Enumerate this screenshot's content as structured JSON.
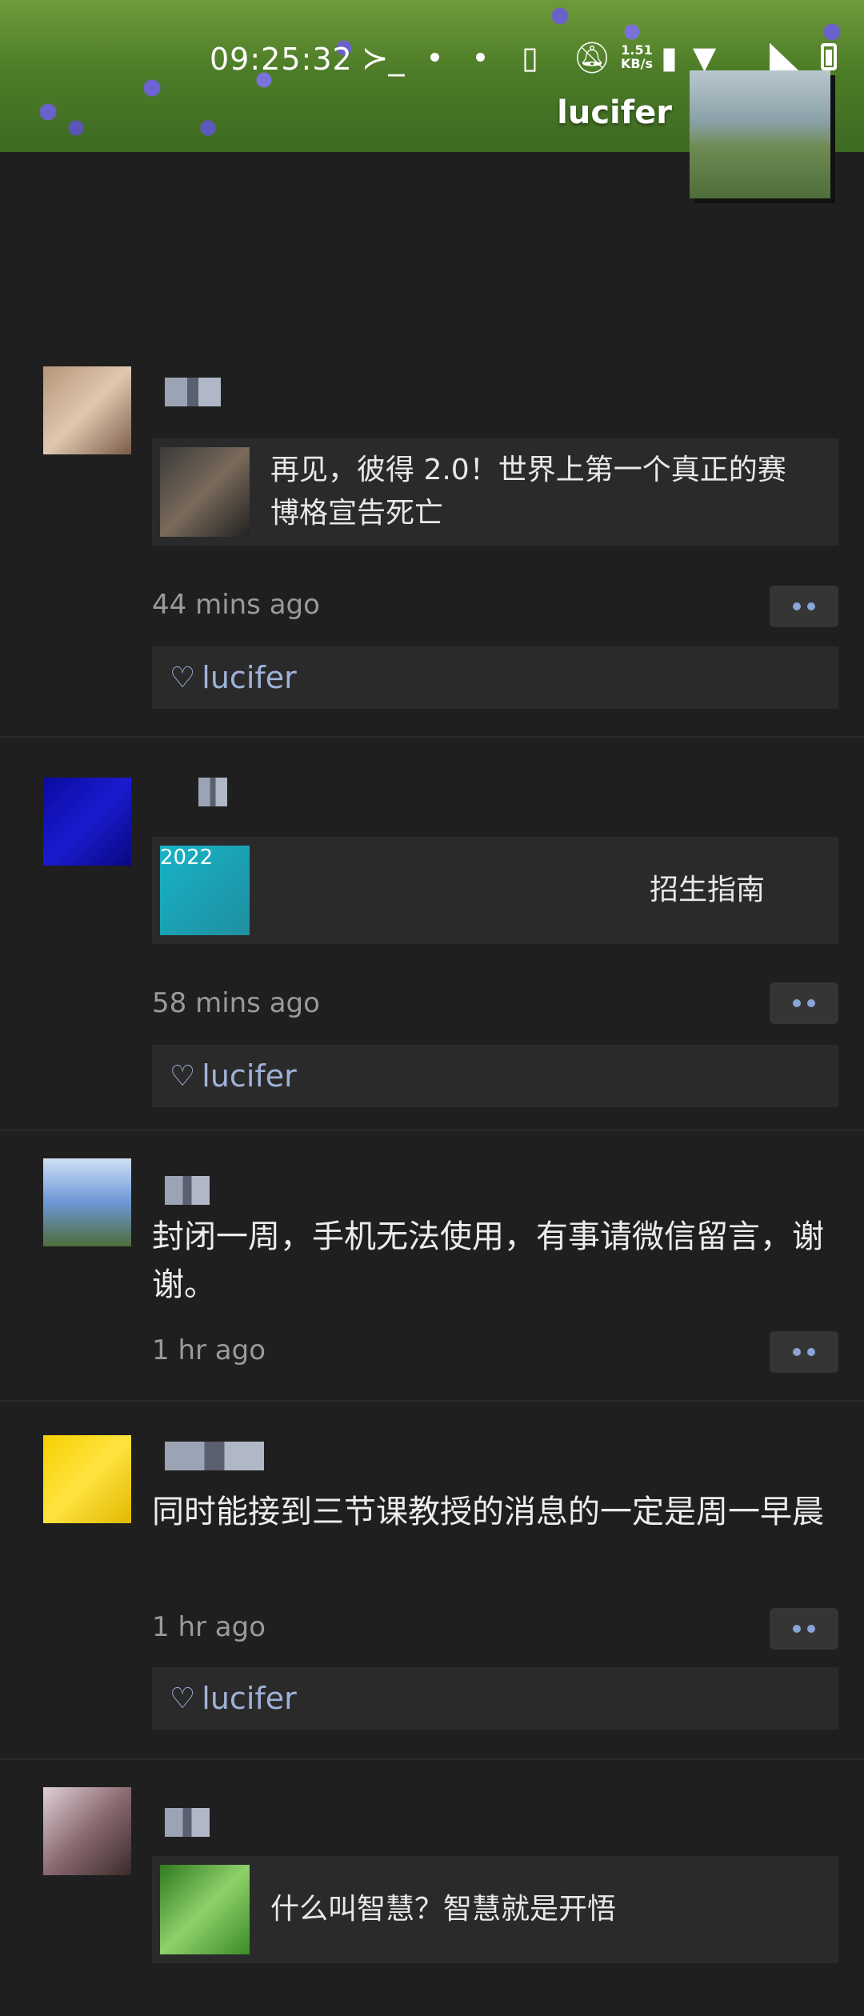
{
  "status_bar": {
    "time": "09:25:32",
    "prompt_icon": "terminal-icon",
    "net_speed_value": "1.51",
    "net_speed_unit": "KB/s"
  },
  "profile": {
    "name": "lucifer"
  },
  "posts": [
    {
      "share": {
        "title": "再见，彼得 2.0！世界上第一个真正的赛博格宣告死亡"
      },
      "time": "44 mins ago",
      "likes": "lucifer"
    },
    {
      "share": {
        "title": "招生指南",
        "thumb_text": "2022"
      },
      "time": "58 mins ago",
      "likes": "lucifer"
    },
    {
      "text": "封闭一周，手机无法使用，有事请微信留言，谢谢。",
      "time": "1 hr ago"
    },
    {
      "text": "同时能接到三节课教授的消息的一定是周一早晨",
      "time": "1 hr ago",
      "likes": "lucifer"
    },
    {
      "share": {
        "title": "什么叫智慧？智慧就是开悟"
      }
    }
  ]
}
